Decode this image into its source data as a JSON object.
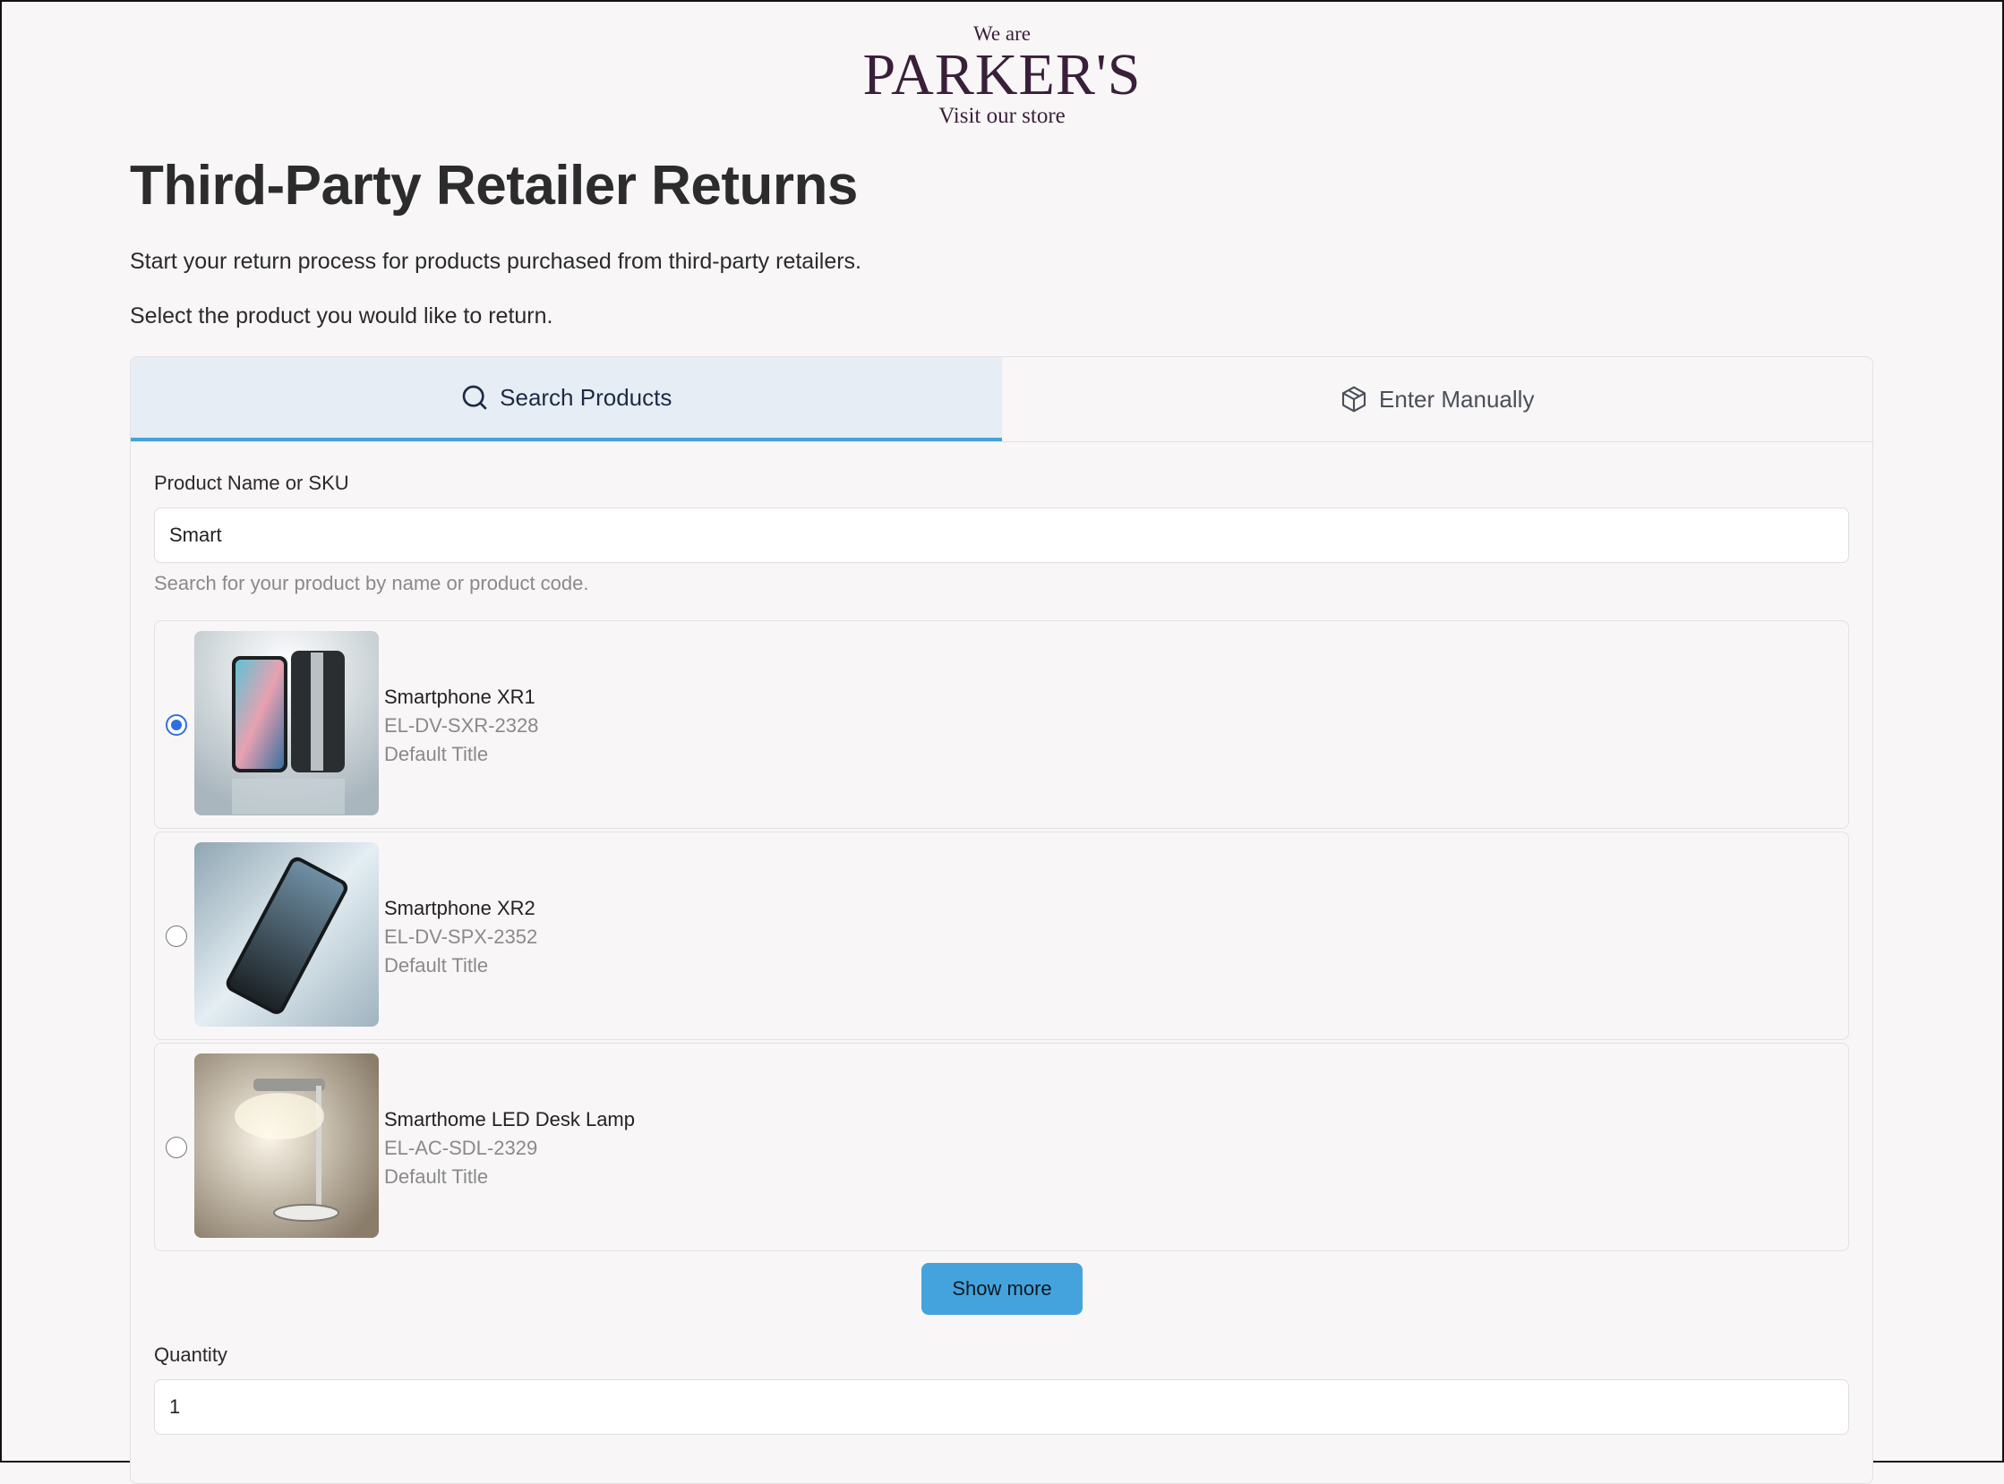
{
  "logo": {
    "top": "We are",
    "brand": "PARKER'S",
    "bottom": "Visit our store"
  },
  "page": {
    "title": "Third-Party Retailer Returns",
    "intro": "Start your return process for products purchased from third-party retailers.",
    "instruction": "Select the product you would like to return."
  },
  "tabs": [
    {
      "label": "Search Products",
      "icon": "search-icon",
      "active": true
    },
    {
      "label": "Enter Manually",
      "icon": "box-icon",
      "active": false
    }
  ],
  "search": {
    "label": "Product Name or SKU",
    "value": "Smart",
    "hint": "Search for your product by name or product code."
  },
  "products": [
    {
      "name": "Smartphone XR1",
      "sku": "EL-DV-SXR-2328",
      "variant": "Default Title",
      "selected": true
    },
    {
      "name": "Smartphone XR2",
      "sku": "EL-DV-SPX-2352",
      "variant": "Default Title",
      "selected": false
    },
    {
      "name": "Smarthome LED Desk Lamp",
      "sku": "EL-AC-SDL-2329",
      "variant": "Default Title",
      "selected": false
    }
  ],
  "show_more_label": "Show more",
  "quantity": {
    "label": "Quantity",
    "value": "1"
  },
  "colors": {
    "accent": "#44a3dc",
    "radio": "#2f6fe0",
    "brand": "#3a1f3a"
  }
}
